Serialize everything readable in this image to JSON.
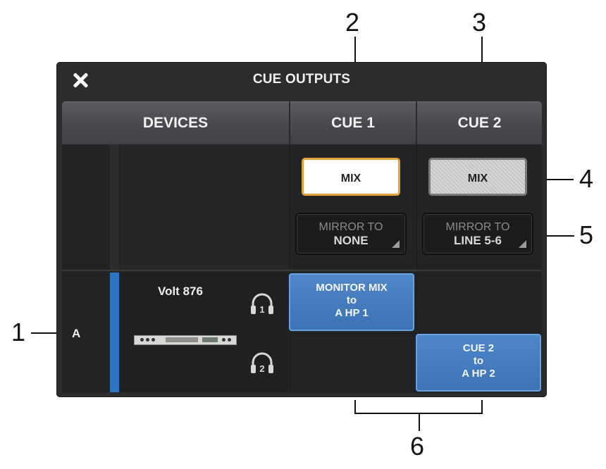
{
  "window": {
    "title": "CUE OUTPUTS",
    "close_icon": "close-icon"
  },
  "columns": {
    "devices": "DEVICES",
    "cue1": "CUE 1",
    "cue2": "CUE 2"
  },
  "cue1": {
    "mix_label": "MIX",
    "mirror_line1": "MIRROR TO",
    "mirror_value": "NONE"
  },
  "cue2": {
    "mix_label": "MIX",
    "mirror_line1": "MIRROR TO",
    "mirror_value": "LINE 5-6"
  },
  "device": {
    "row_letter": "A",
    "name": "Volt 876",
    "hp1_label": "1",
    "hp2_label": "2"
  },
  "routes": {
    "cue1": [
      "MONITOR MIX",
      "to",
      "A HP 1"
    ],
    "cue2": [
      "CUE 2",
      "to",
      "A HP 2"
    ]
  },
  "callouts": {
    "c1": "1",
    "c2": "2",
    "c3": "3",
    "c4": "4",
    "c5": "5",
    "c6": "6"
  },
  "colors": {
    "accent_orange": "#e3a23a",
    "route_blue": "#3d73b6",
    "device_bar": "#2f74c0"
  }
}
